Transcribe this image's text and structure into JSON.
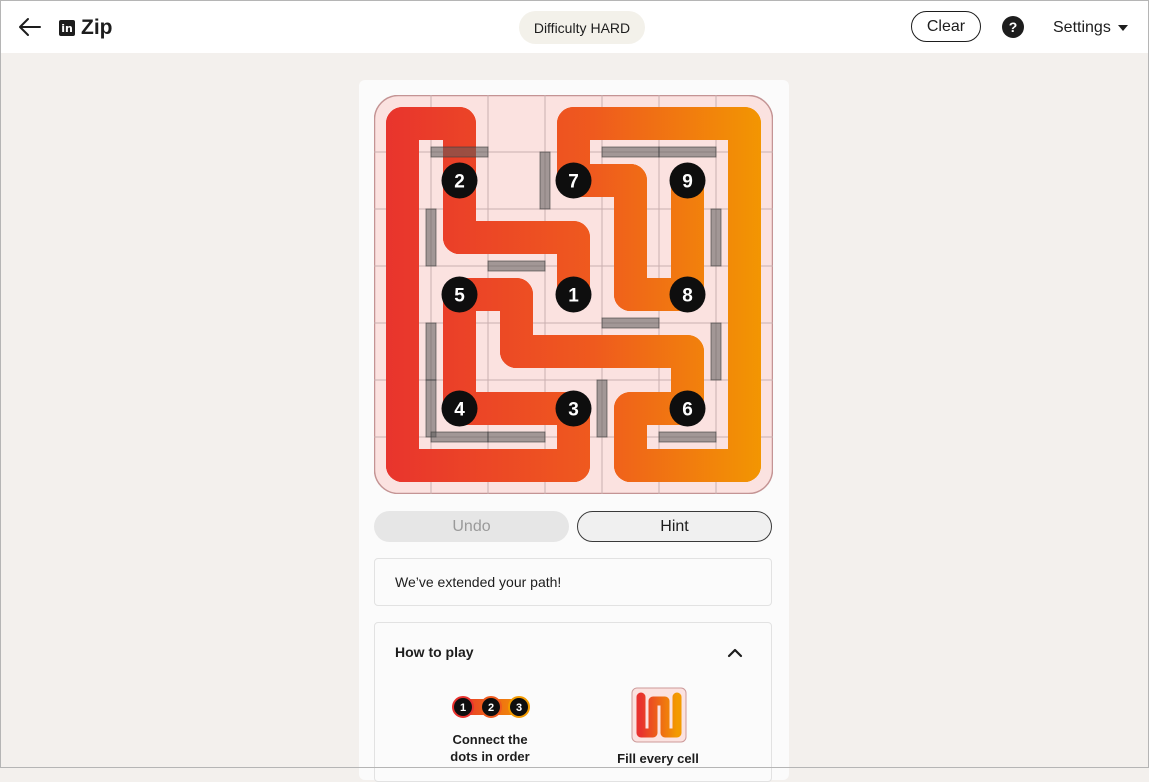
{
  "header": {
    "app_title": "Zip",
    "linkedin_icon_text": "in",
    "difficulty_label": "Difficulty",
    "difficulty_level": "HARD",
    "clear_label": "Clear",
    "help_label": "?",
    "settings_label": "Settings"
  },
  "puzzle": {
    "rows": 7,
    "cols": 7,
    "numbered_cells": [
      {
        "number": "1",
        "row": 3,
        "col": 3
      },
      {
        "number": "2",
        "row": 1,
        "col": 1
      },
      {
        "number": "3",
        "row": 5,
        "col": 3
      },
      {
        "number": "4",
        "row": 5,
        "col": 1
      },
      {
        "number": "5",
        "row": 3,
        "col": 1
      },
      {
        "number": "6",
        "row": 5,
        "col": 5
      },
      {
        "number": "7",
        "row": 1,
        "col": 3
      },
      {
        "number": "8",
        "row": 3,
        "col": 5
      },
      {
        "number": "9",
        "row": 1,
        "col": 5
      }
    ],
    "walls": [
      {
        "side": "bottom",
        "row": 0,
        "col": 1
      },
      {
        "side": "right",
        "row": 1,
        "col": 2
      },
      {
        "side": "bottom",
        "row": 0,
        "col": 4
      },
      {
        "side": "bottom",
        "row": 0,
        "col": 5
      },
      {
        "side": "right",
        "row": 2,
        "col": 0
      },
      {
        "side": "bottom",
        "row": 2,
        "col": 2
      },
      {
        "side": "right",
        "row": 2,
        "col": 5
      },
      {
        "side": "bottom",
        "row": 3,
        "col": 4
      },
      {
        "side": "right",
        "row": 4,
        "col": 0
      },
      {
        "side": "right",
        "row": 5,
        "col": 0
      },
      {
        "side": "right",
        "row": 4,
        "col": 5
      },
      {
        "side": "right",
        "row": 5,
        "col": 3
      },
      {
        "side": "bottom",
        "row": 5,
        "col": 1
      },
      {
        "side": "bottom",
        "row": 5,
        "col": 2
      },
      {
        "side": "bottom",
        "row": 5,
        "col": 5
      }
    ],
    "path": [
      [
        3,
        3
      ],
      [
        2,
        3
      ],
      [
        2,
        2
      ],
      [
        2,
        1
      ],
      [
        1,
        1
      ],
      [
        0,
        1
      ],
      [
        0,
        0
      ],
      [
        1,
        0
      ],
      [
        2,
        0
      ],
      [
        3,
        0
      ],
      [
        4,
        0
      ],
      [
        5,
        0
      ],
      [
        6,
        0
      ],
      [
        6,
        1
      ],
      [
        6,
        2
      ],
      [
        6,
        3
      ],
      [
        5,
        3
      ],
      [
        5,
        2
      ],
      [
        5,
        1
      ],
      [
        4,
        1
      ],
      [
        3,
        1
      ],
      [
        3,
        2
      ],
      [
        4,
        2
      ],
      [
        4,
        3
      ],
      [
        4,
        4
      ],
      [
        4,
        5
      ],
      [
        5,
        5
      ],
      [
        5,
        4
      ],
      [
        6,
        4
      ],
      [
        6,
        5
      ],
      [
        6,
        6
      ],
      [
        5,
        6
      ],
      [
        4,
        6
      ],
      [
        3,
        6
      ],
      [
        2,
        6
      ],
      [
        1,
        6
      ],
      [
        0,
        6
      ],
      [
        0,
        5
      ],
      [
        0,
        4
      ],
      [
        0,
        3
      ],
      [
        1,
        3
      ],
      [
        1,
        4
      ],
      [
        2,
        4
      ],
      [
        3,
        4
      ],
      [
        3,
        5
      ],
      [
        2,
        5
      ],
      [
        1,
        5
      ]
    ],
    "colors": {
      "path_start": "#e8322e",
      "path_mid": "#ef5a1e",
      "path_end": "#f39a00",
      "dot": "#0e0e0e",
      "board_tint": "#fbe2e0"
    }
  },
  "controls": {
    "undo_label": "Undo",
    "hint_label": "Hint"
  },
  "message": "We’ve extended your path!",
  "how_to_play": {
    "title": "How to play",
    "tip1_dots": [
      "1",
      "2",
      "3"
    ],
    "tip1_line1": "Connect the",
    "tip1_line2": "dots in order",
    "tip2_text": "Fill every cell"
  }
}
